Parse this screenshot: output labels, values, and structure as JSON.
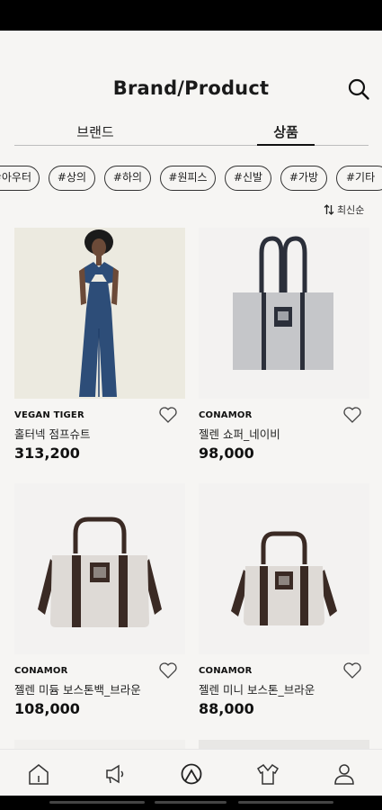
{
  "header": {
    "title": "Brand/Product",
    "search_icon": "search-icon"
  },
  "tabs": [
    {
      "label": "브랜드",
      "active": false
    },
    {
      "label": "상품",
      "active": true
    }
  ],
  "categories": [
    "#아우터",
    "#상의",
    "#하의",
    "#원피스",
    "#신발",
    "#가방",
    "#기타"
  ],
  "sort": {
    "label": "최신순",
    "icon": "sort-arrows-icon"
  },
  "products": [
    {
      "brand": "VEGAN TIGER",
      "name": "홀터넥 점프슈트",
      "price": "313,200"
    },
    {
      "brand": "CONAMOR",
      "name": "젤렌 쇼퍼_네이비",
      "price": "98,000"
    },
    {
      "brand": "CONAMOR",
      "name": "젤렌 미듐 보스톤백_브라운",
      "price": "108,000"
    },
    {
      "brand": "CONAMOR",
      "name": "젤렌 미니 보스톤_브라운",
      "price": "88,000"
    }
  ],
  "bottom_nav": [
    {
      "icon": "home-icon"
    },
    {
      "icon": "megaphone-icon"
    },
    {
      "icon": "brand-logo-icon"
    },
    {
      "icon": "shirt-icon"
    },
    {
      "icon": "profile-icon"
    }
  ],
  "colors": {
    "background": "#f6f5f3",
    "text": "#111111",
    "photo_bg": "#eceae0"
  }
}
